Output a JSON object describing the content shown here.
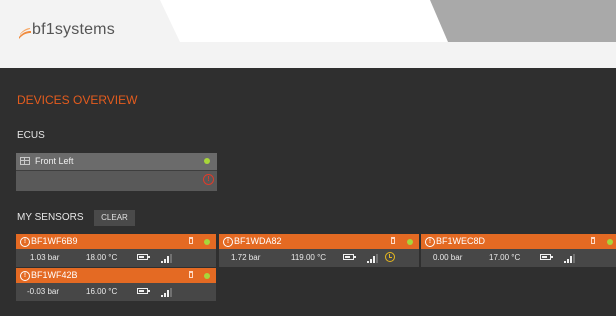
{
  "header": {
    "logo_text": "bf1systems",
    "top_right_text": "",
    "colors": {
      "accent": "#e45c1e",
      "logo_swoosh": "#f08a3c"
    }
  },
  "page": {
    "title": "DEVICES OVERVIEW"
  },
  "ecus": {
    "label": "ECUS",
    "items": [
      {
        "name": "Front Left",
        "status": "online",
        "warning": true,
        "icon": "grid-icon"
      }
    ]
  },
  "sensors": {
    "label": "MY SENSORS",
    "clear_label": "CLEAR",
    "items": [
      {
        "id": "BF1WF6B9",
        "pressure": "1.03 bar",
        "temperature": "18.00 °C",
        "battery": 0.7,
        "signal": 0.75,
        "timer": false
      },
      {
        "id": "BF1WDA82",
        "pressure": "1.72 bar",
        "temperature": "119.00 °C",
        "battery": 0.7,
        "signal": 0.75,
        "timer": true
      },
      {
        "id": "BF1WEC8D",
        "pressure": "0.00 bar",
        "temperature": "17.00 °C",
        "battery": 0.7,
        "signal": 0.75,
        "timer": false
      },
      {
        "id": "BF1WF42B",
        "pressure": "-0.03 bar",
        "temperature": "16.00 °C",
        "battery": 0.7,
        "signal": 0.75,
        "timer": false
      }
    ]
  }
}
